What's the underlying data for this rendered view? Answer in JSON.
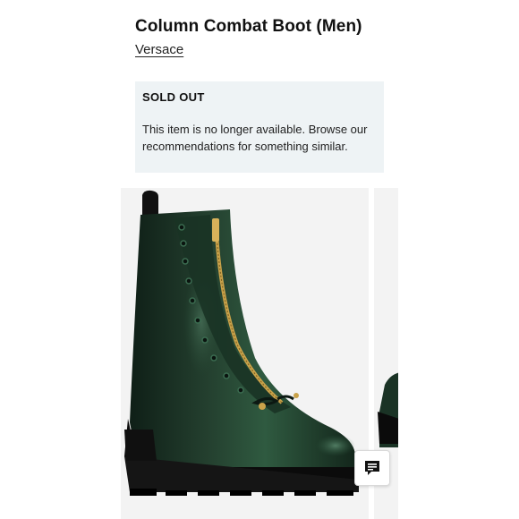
{
  "product": {
    "title": "Column Combat Boot (Men)",
    "brand": "Versace"
  },
  "availability": {
    "status": "SOLD OUT",
    "message": "This item is no longer available. Browse our recommendations for something similar."
  },
  "gallery": {
    "image_subject": "dark green leather combat boot with gold front zipper",
    "icons": {
      "chat": "chat-bubble-icon"
    }
  },
  "colors": {
    "notice_bg": "#eef3f5",
    "boot_green": "#1f3a2c",
    "zipper_gold": "#c9a24a"
  }
}
